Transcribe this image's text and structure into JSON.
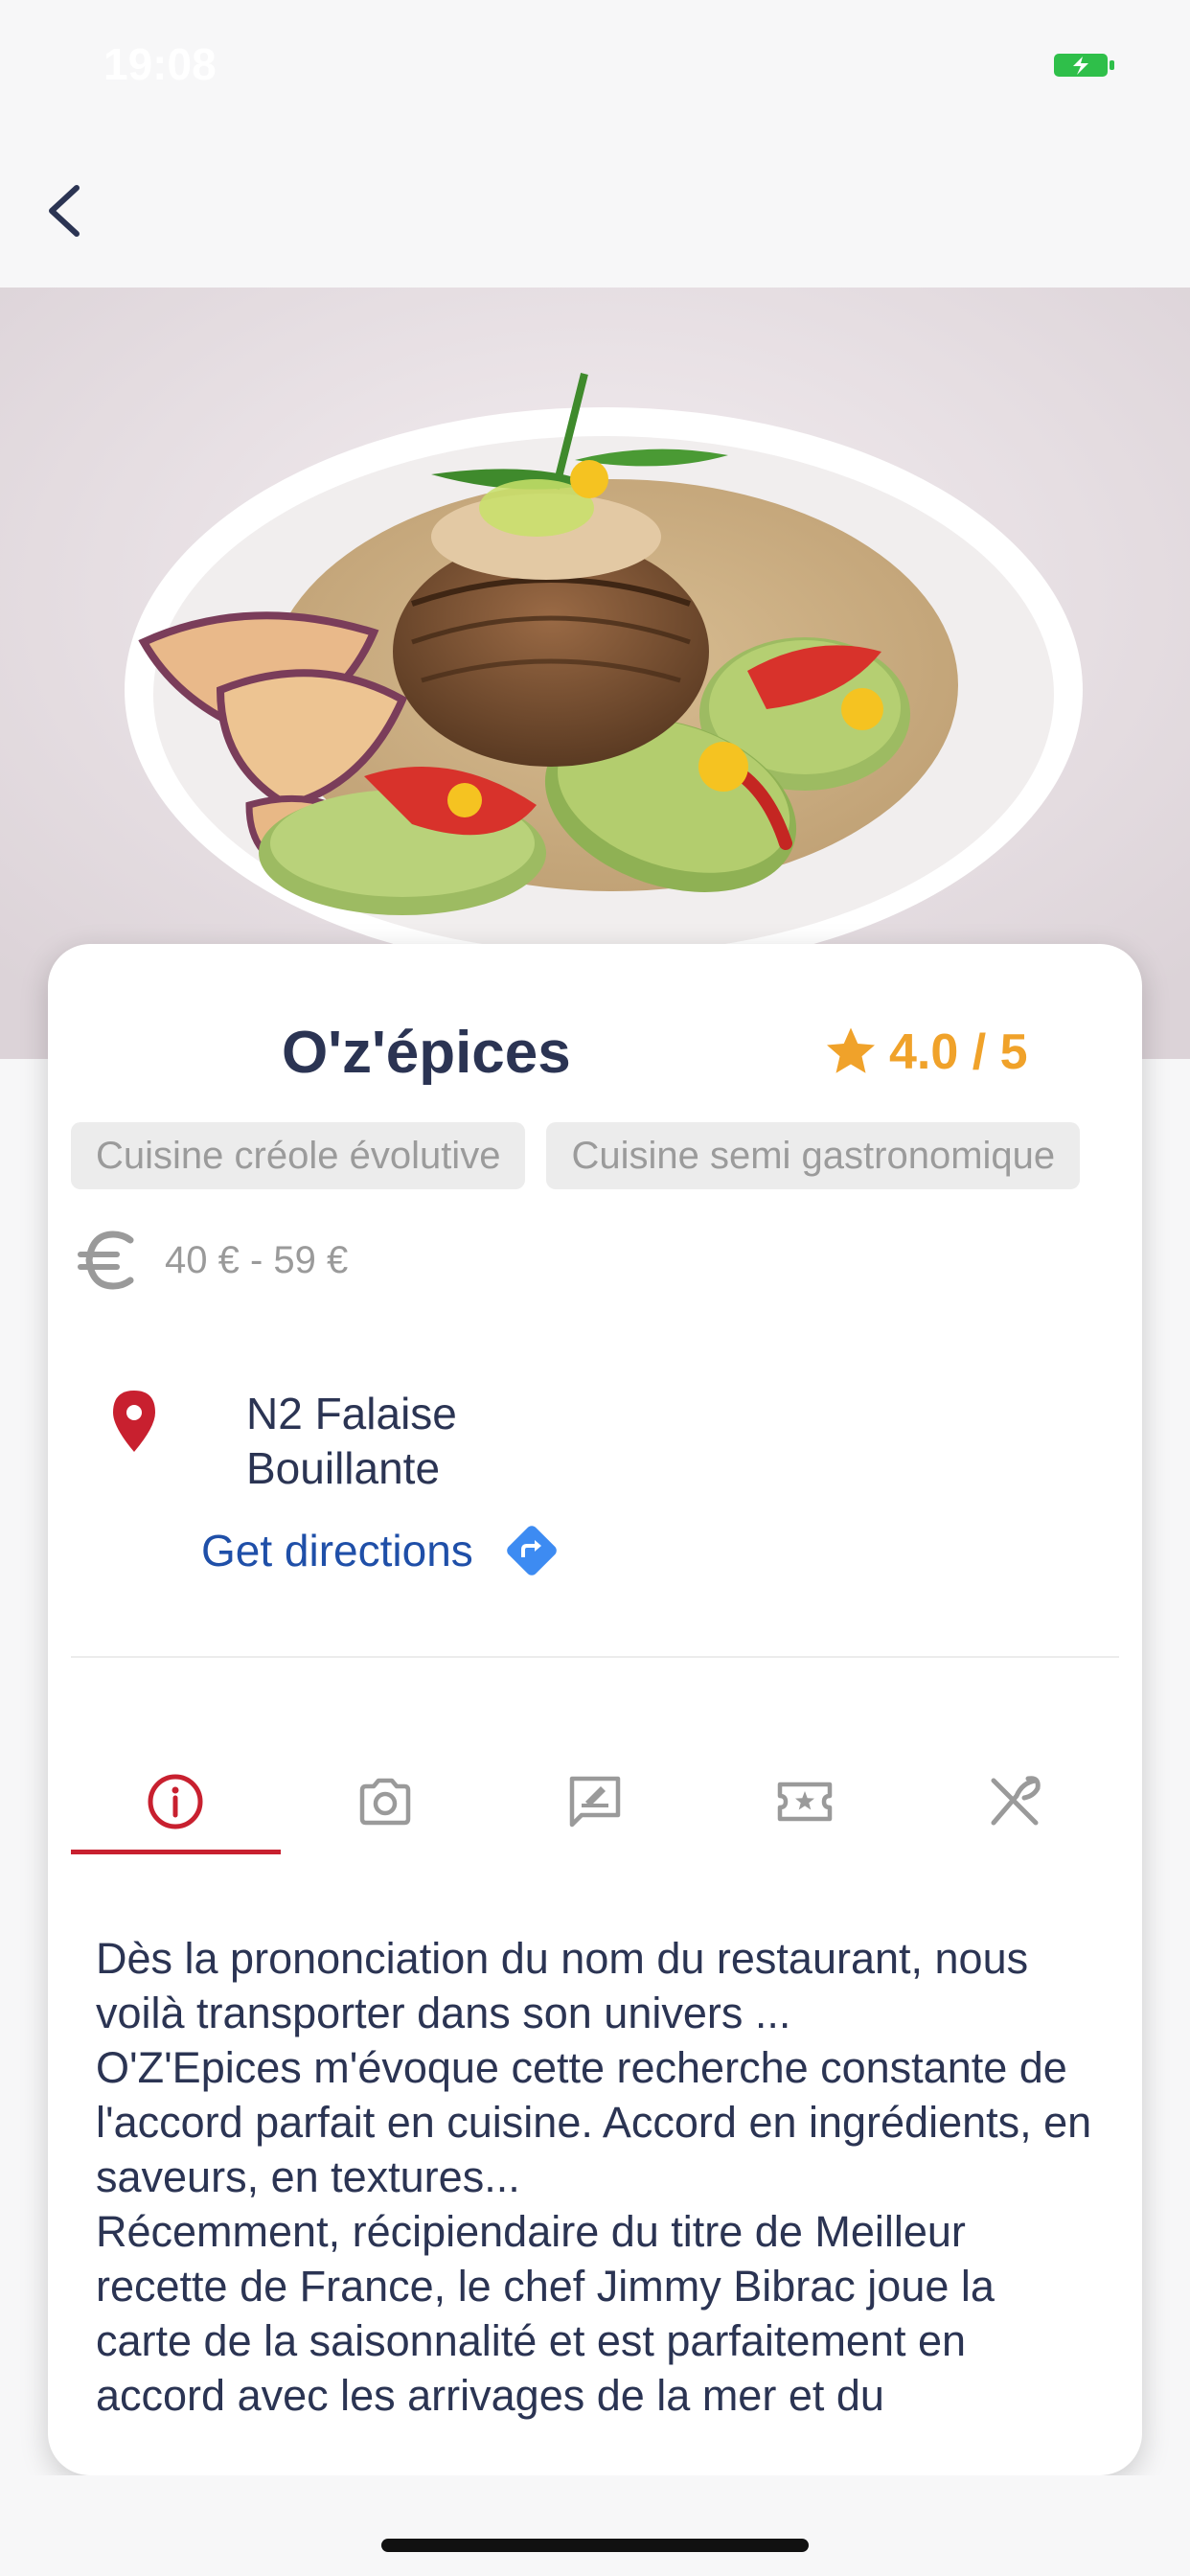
{
  "status_bar": {
    "time": "19:08"
  },
  "restaurant": {
    "name": "O'z'épices",
    "rating": "4.0 / 5",
    "tags": [
      "Cuisine créole évolutive",
      "Cuisine semi gastronomique"
    ],
    "price_range": "40 € - 59 €",
    "address_line1": "N2 Falaise",
    "address_line2": "Bouillante",
    "directions_label": "Get directions"
  },
  "tabs": [
    {
      "id": "info",
      "icon": "info-icon",
      "active": true
    },
    {
      "id": "photos",
      "icon": "camera-icon",
      "active": false
    },
    {
      "id": "reviews",
      "icon": "review-icon",
      "active": false
    },
    {
      "id": "offers",
      "icon": "ticket-star-icon",
      "active": false
    },
    {
      "id": "menu",
      "icon": "cutlery-icon",
      "active": false
    }
  ],
  "description": [
    "Dès la prononciation du nom du restaurant, nous voilà transporter dans son univers ...",
    "O'Z'Epices m'évoque cette recherche constante de l'accord parfait en cuisine. Accord en ingrédients, en saveurs, en textures...",
    "Récemment, récipiendaire du titre de Meilleur recette de France, le chef Jimmy Bibrac joue la carte de la saisonnalité et est parfaitement en accord avec les arrivages de la mer et du"
  ],
  "colors": {
    "accent_red": "#c8202f",
    "rating_orange": "#f0a22a",
    "link_blue": "#1f4fa8",
    "title_navy": "#2b3453",
    "battery_green": "#2fbf4a"
  }
}
